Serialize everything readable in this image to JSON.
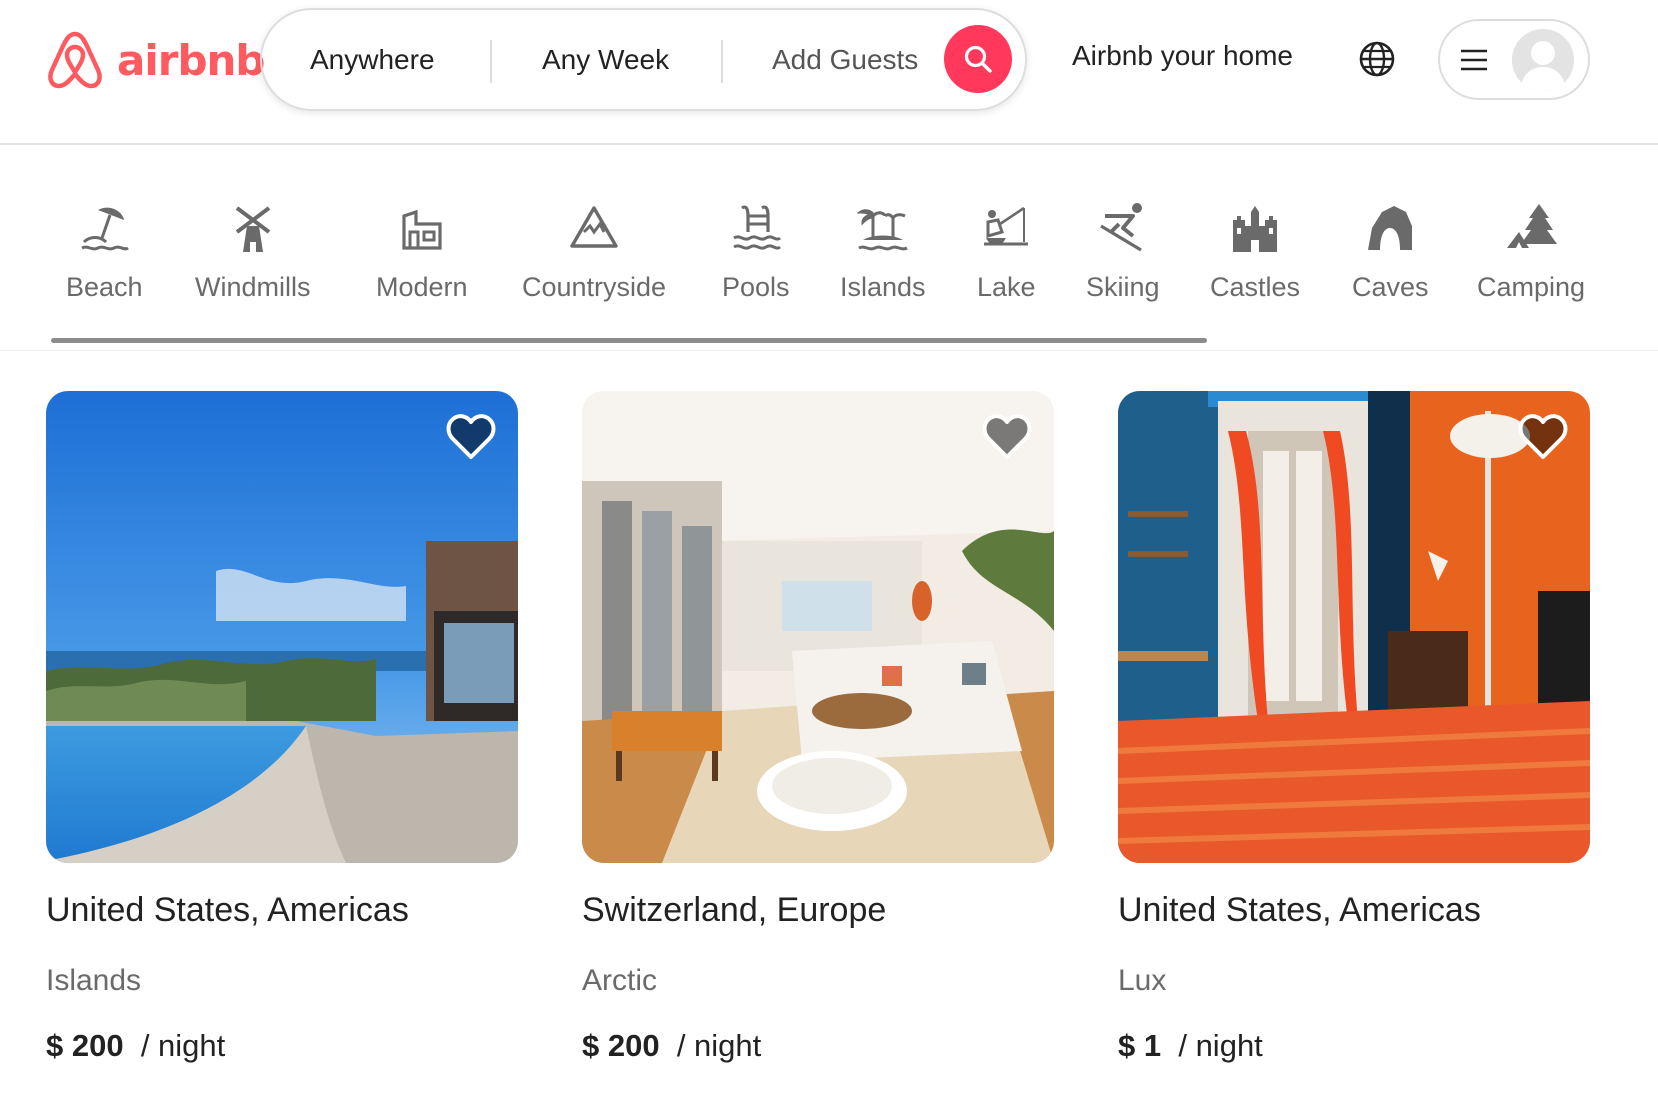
{
  "brand": {
    "name": "airbnb",
    "color": "#ff5a5f"
  },
  "search": {
    "anywhere": "Anywhere",
    "any_week": "Any Week",
    "add_guests": "Add Guests",
    "button_color": "#ff385c",
    "button_icon": "search-icon"
  },
  "header": {
    "host_link": "Airbnb your home",
    "globe_icon": "globe-icon",
    "menu_icon": "hamburger-icon",
    "avatar_icon": "user-avatar-icon"
  },
  "categories": [
    {
      "label": "Beach",
      "icon": "beach-icon"
    },
    {
      "label": "Windmills",
      "icon": "windmill-icon"
    },
    {
      "label": "Modern",
      "icon": "modern-house-icon"
    },
    {
      "label": "Countryside",
      "icon": "mountain-icon"
    },
    {
      "label": "Pools",
      "icon": "pool-icon"
    },
    {
      "label": "Islands",
      "icon": "island-icon"
    },
    {
      "label": "Lake",
      "icon": "lake-icon"
    },
    {
      "label": "Skiing",
      "icon": "skiing-icon"
    },
    {
      "label": "Castles",
      "icon": "castle-icon"
    },
    {
      "label": "Caves",
      "icon": "cave-icon"
    },
    {
      "label": "Camping",
      "icon": "camping-icon"
    }
  ],
  "listings": [
    {
      "location": "United States, Americas",
      "category": "Islands",
      "price": "$ 200",
      "unit": "/ night",
      "photo": "infinity-pool-ocean-view"
    },
    {
      "location": "Switzerland, Europe",
      "category": "Arctic",
      "price": "$ 200",
      "unit": "/ night",
      "photo": "bright-living-room"
    },
    {
      "location": "United States, Americas",
      "category": "Lux",
      "price": "$ 1",
      "unit": "/ night",
      "photo": "orange-blue-bedroom"
    }
  ]
}
